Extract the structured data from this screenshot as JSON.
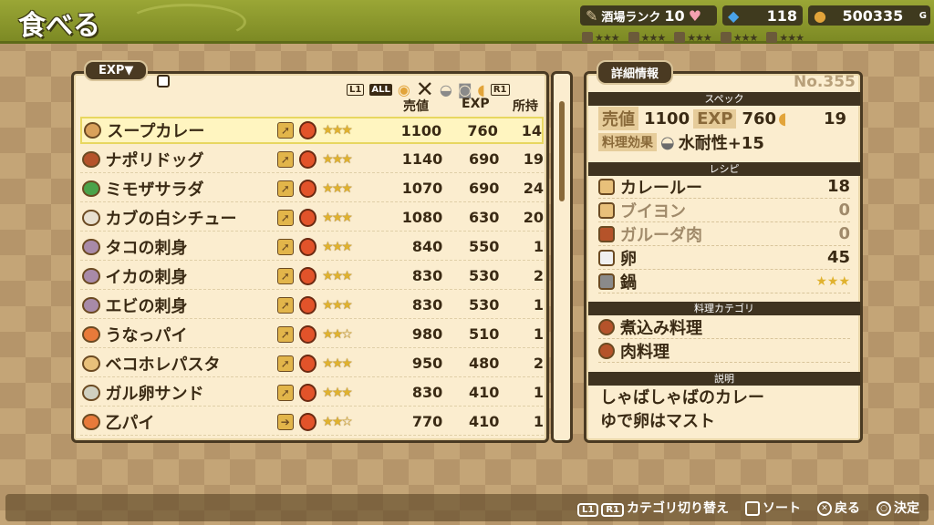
{
  "header": {
    "title": "食べる",
    "rank_label": "酒場ランク",
    "rank_value": "10",
    "gem_count": "118",
    "gold": "500335",
    "gold_unit": "G"
  },
  "minis": [
    "★★★",
    "★★★",
    "★★★",
    "★★★",
    "★★★",
    "★★★"
  ],
  "list": {
    "sort_label": "EXP▼",
    "filter_l1": "L1",
    "filter_all": "ALL",
    "filter_r1": "R1",
    "col_price": "売値",
    "col_exp": "EXP",
    "col_owned": "所持",
    "items": [
      {
        "name": "スープカレー",
        "stars": "★★★",
        "price": "1100",
        "exp": "760",
        "owned": "14",
        "color": "#d9a15a",
        "arrow": "➚"
      },
      {
        "name": "ナポリドッグ",
        "stars": "★★★",
        "price": "1140",
        "exp": "690",
        "owned": "19",
        "color": "#b5532a",
        "arrow": "➚"
      },
      {
        "name": "ミモザサラダ",
        "stars": "★★★",
        "price": "1070",
        "exp": "690",
        "owned": "24",
        "color": "#4aa34a",
        "arrow": "➚"
      },
      {
        "name": "カブの白シチュー",
        "stars": "★★★",
        "price": "1080",
        "exp": "630",
        "owned": "20",
        "color": "#e8e0d0",
        "arrow": "➚"
      },
      {
        "name": "タコの刺身",
        "stars": "★★★",
        "price": "840",
        "exp": "550",
        "owned": "1",
        "color": "#a88aa8",
        "arrow": "➚"
      },
      {
        "name": "イカの刺身",
        "stars": "★★★",
        "price": "830",
        "exp": "530",
        "owned": "2",
        "color": "#a88aa8",
        "arrow": "➚"
      },
      {
        "name": "エビの刺身",
        "stars": "★★★",
        "price": "830",
        "exp": "530",
        "owned": "1",
        "color": "#a88aa8",
        "arrow": "➚"
      },
      {
        "name": "うなっパイ",
        "stars": "★★☆",
        "price": "980",
        "exp": "510",
        "owned": "1",
        "color": "#e87a3a",
        "arrow": "➚"
      },
      {
        "name": "ベコホレパスタ",
        "stars": "★★★",
        "price": "950",
        "exp": "480",
        "owned": "2",
        "color": "#e8c07a",
        "arrow": "➚"
      },
      {
        "name": "ガル卵サンド",
        "stars": "★★★",
        "price": "830",
        "exp": "410",
        "owned": "1",
        "color": "#d0d0c0",
        "arrow": "➚"
      },
      {
        "name": "乙パイ",
        "stars": "★★☆",
        "price": "770",
        "exp": "410",
        "owned": "1",
        "color": "#e87a3a",
        "arrow": "➔"
      }
    ]
  },
  "detail": {
    "tag": "詳細情報",
    "number": "No.355",
    "spec_label": "スペック",
    "price_label": "売値",
    "price": "1100",
    "exp_label": "EXP",
    "exp": "760",
    "owned": "19",
    "effect_label": "料理効果",
    "effect": "水耐性+15",
    "recipe_label": "レシピ",
    "recipe": [
      {
        "name": "カレールー",
        "qty": "18",
        "color": "#e8c07a",
        "dim": false
      },
      {
        "name": "ブイヨン",
        "qty": "0",
        "color": "#e8c07a",
        "dim": true
      },
      {
        "name": "ガルーダ肉",
        "qty": "0",
        "color": "#b5532a",
        "dim": true
      },
      {
        "name": "卵",
        "qty": "45",
        "color": "#f0f0f0",
        "dim": false
      },
      {
        "name": "鍋",
        "qty": "★★★",
        "color": "#8a8a8a",
        "dim": false
      }
    ],
    "category_label": "料理カテゴリ",
    "categories": [
      {
        "name": "煮込み料理",
        "color": "#b5532a"
      },
      {
        "name": "肉料理",
        "color": "#b5532a"
      }
    ],
    "desc_label": "説明",
    "desc_line1": "しゃばしゃばのカレー",
    "desc_line2": "ゆで卵はマスト"
  },
  "footer": {
    "l1": "L1",
    "r1": "R1",
    "switch": "カテゴリ切り替え",
    "sort": "ソート",
    "back": "戻る",
    "confirm": "決定"
  }
}
